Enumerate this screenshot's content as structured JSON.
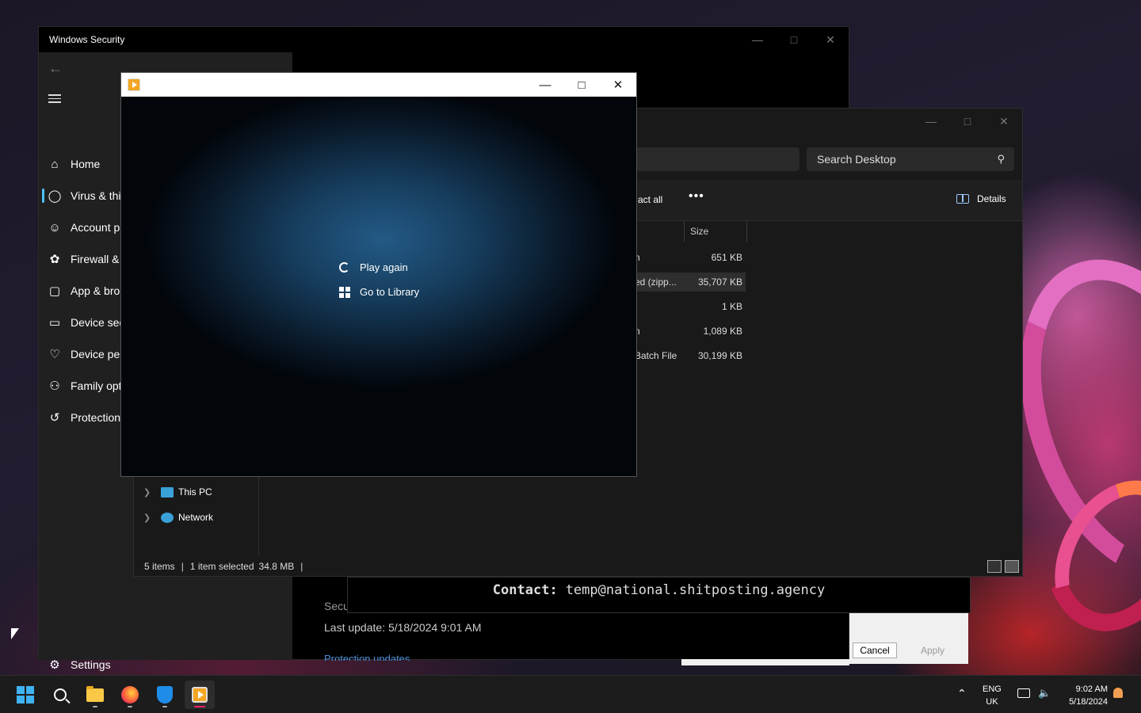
{
  "windows_security": {
    "title": "Windows Security",
    "nav_items": [
      {
        "label": "Home",
        "icon": "home-icon"
      },
      {
        "label": "Virus & thi",
        "icon": "shield-icon"
      },
      {
        "label": "Account p",
        "icon": "person-icon"
      },
      {
        "label": "Firewall &",
        "icon": "antenna-icon"
      },
      {
        "label": "App & bro",
        "icon": "app-window-icon"
      },
      {
        "label": "Device sec",
        "icon": "laptop-icon"
      },
      {
        "label": "Device per",
        "icon": "heart-pulse-icon"
      },
      {
        "label": "Family opt",
        "icon": "family-icon"
      },
      {
        "label": "Protection",
        "icon": "history-icon"
      }
    ],
    "settings_label": "Settings",
    "main_partial": "Secu",
    "last_update": "Last update: 5/18/2024 9:01 AM",
    "protection_updates_link": "Protection updates"
  },
  "explorer": {
    "search_placeholder": "Search Desktop",
    "extract_all_partial": "act all",
    "more_label": "•••",
    "details_label": "Details",
    "size_column": "Size",
    "rows": [
      {
        "type": "n",
        "size": "651 KB",
        "selected": false
      },
      {
        "type": "ed (zipp...",
        "size": "35,707 KB",
        "selected": true
      },
      {
        "type": "",
        "size": "1 KB",
        "selected": false
      },
      {
        "type": "n",
        "size": "1,089 KB",
        "selected": false
      },
      {
        "type": "Batch File",
        "size": "30,199 KB",
        "selected": false
      }
    ],
    "tree": [
      {
        "label": "This PC"
      },
      {
        "label": "Network"
      }
    ],
    "status": {
      "items": "5 items",
      "selected": "1 item selected",
      "size": "34.8 MB"
    }
  },
  "contact": {
    "label": "Contact:",
    "email": "temp@national.shitposting.agency"
  },
  "dialog": {
    "cancel": "Cancel",
    "apply": "Apply"
  },
  "player": {
    "play_again": "Play again",
    "go_to_library": "Go to Library"
  },
  "taskbar": {
    "lang_line1": "ENG",
    "lang_line2": "UK",
    "time": "9:02 AM",
    "date": "5/18/2024"
  },
  "colors": {
    "accent": "#4cc2ff",
    "start": "#3fb4f4"
  }
}
